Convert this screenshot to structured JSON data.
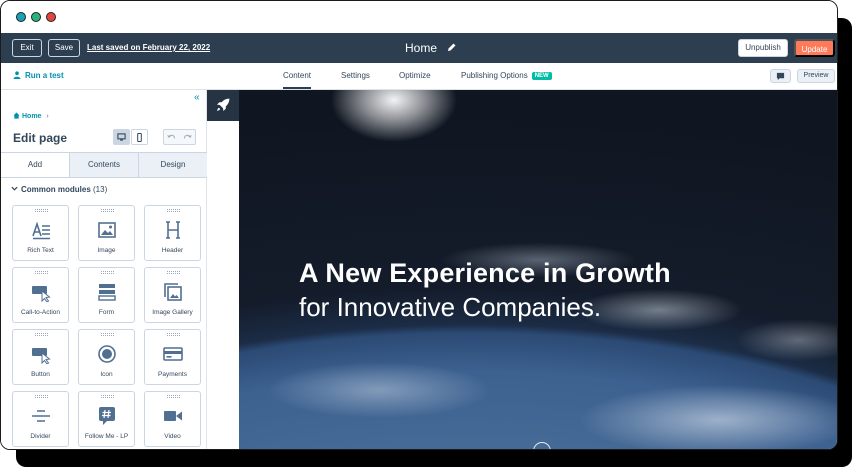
{
  "toolbar": {
    "exit_label": "Exit",
    "save_label": "Save",
    "last_saved": "Last saved on February 22, 2022",
    "page_name": "Home",
    "unpublish_label": "Unpublish",
    "update_label": "Update"
  },
  "subnav": {
    "run_test": "Run a test",
    "tabs": [
      {
        "label": "Content"
      },
      {
        "label": "Settings"
      },
      {
        "label": "Optimize"
      },
      {
        "label": "Publishing Options"
      }
    ],
    "new_badge": "NEW",
    "preview_label": "Preview"
  },
  "sidebar": {
    "collapse_glyph": "«",
    "breadcrumb": "Home",
    "breadcrumb_sep": "›",
    "title": "Edit page",
    "tabs": [
      {
        "label": "Add"
      },
      {
        "label": "Contents"
      },
      {
        "label": "Design"
      }
    ],
    "modules_heading": "Common modules",
    "modules_count": "(13)",
    "modules": [
      {
        "label": "Rich Text",
        "icon": "rich-text-icon"
      },
      {
        "label": "Image",
        "icon": "image-icon"
      },
      {
        "label": "Header",
        "icon": "header-icon"
      },
      {
        "label": "Call-to-Action",
        "icon": "cta-icon"
      },
      {
        "label": "Form",
        "icon": "form-icon"
      },
      {
        "label": "Image Gallery",
        "icon": "image-gallery-icon"
      },
      {
        "label": "Button",
        "icon": "button-icon"
      },
      {
        "label": "Icon",
        "icon": "icon-module-icon"
      },
      {
        "label": "Payments",
        "icon": "payments-icon"
      },
      {
        "label": "Divider",
        "icon": "divider-icon"
      },
      {
        "label": "Follow Me - LP",
        "icon": "hashtag-icon"
      },
      {
        "label": "Video",
        "icon": "video-icon"
      }
    ]
  },
  "hero": {
    "headline": "A New Experience in Growth",
    "subheadline": "for Innovative Companies."
  },
  "colors": {
    "topbar": "#2d3e50",
    "accent": "#0091ae",
    "update": "#ff7a59",
    "new_badge": "#00bda5"
  }
}
